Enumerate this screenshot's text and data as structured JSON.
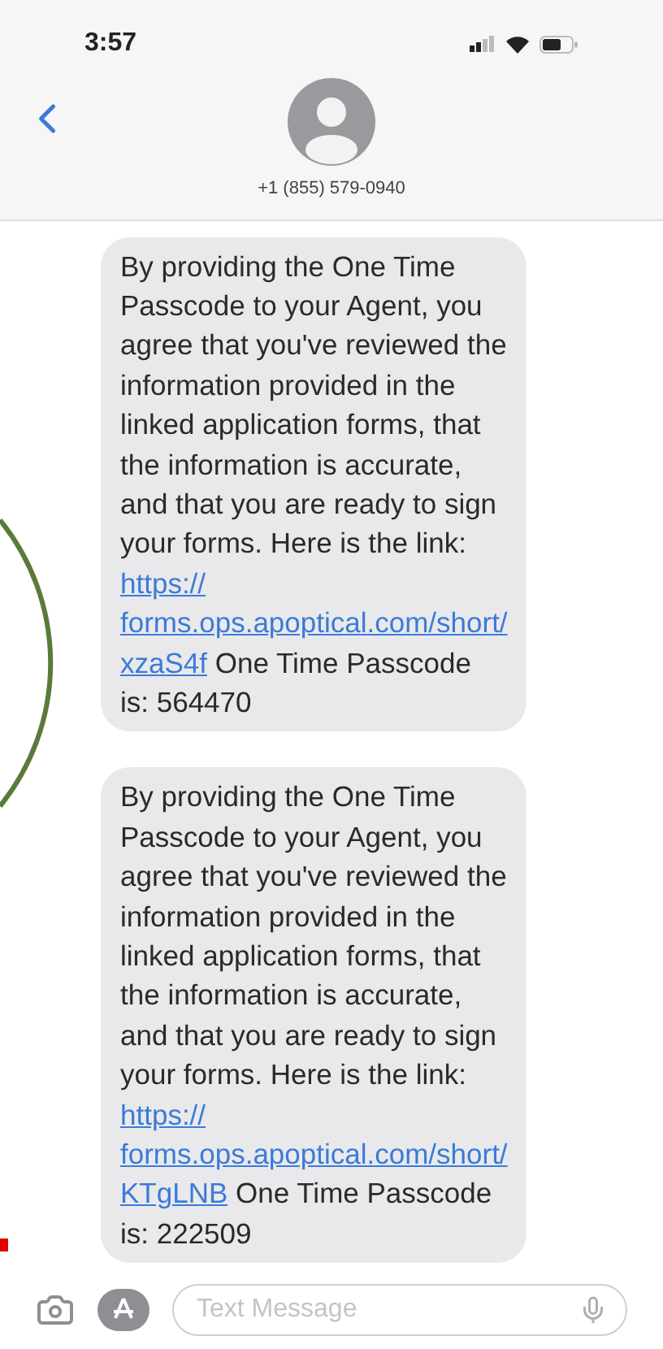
{
  "status_bar": {
    "time": "3:57"
  },
  "header": {
    "contact": "+1 (855) 579-0940"
  },
  "messages": [
    {
      "text": "By providing the One Time Passcode to your Agent, you agree that you've reviewed the information provided in the linked application forms, that the information is accurate, and that you are ready to sign your forms. Here is the link:",
      "link": [
        "https://",
        "forms.ops.apoptical.com/short/",
        "xzaS4f"
      ],
      "after": "One Time Passcode is: 564470"
    },
    {
      "text": "By providing the One Time Passcode to your Agent, you agree that you've reviewed the information provided in the linked application forms, that the information is accurate, and that you are ready to sign your forms. Here is the link:",
      "link": [
        "https://",
        "forms.ops.apoptical.com/short/",
        "KTgLNB"
      ],
      "after": "One Time Passcode is: 222509"
    }
  ],
  "composer": {
    "placeholder": "Text Message"
  }
}
